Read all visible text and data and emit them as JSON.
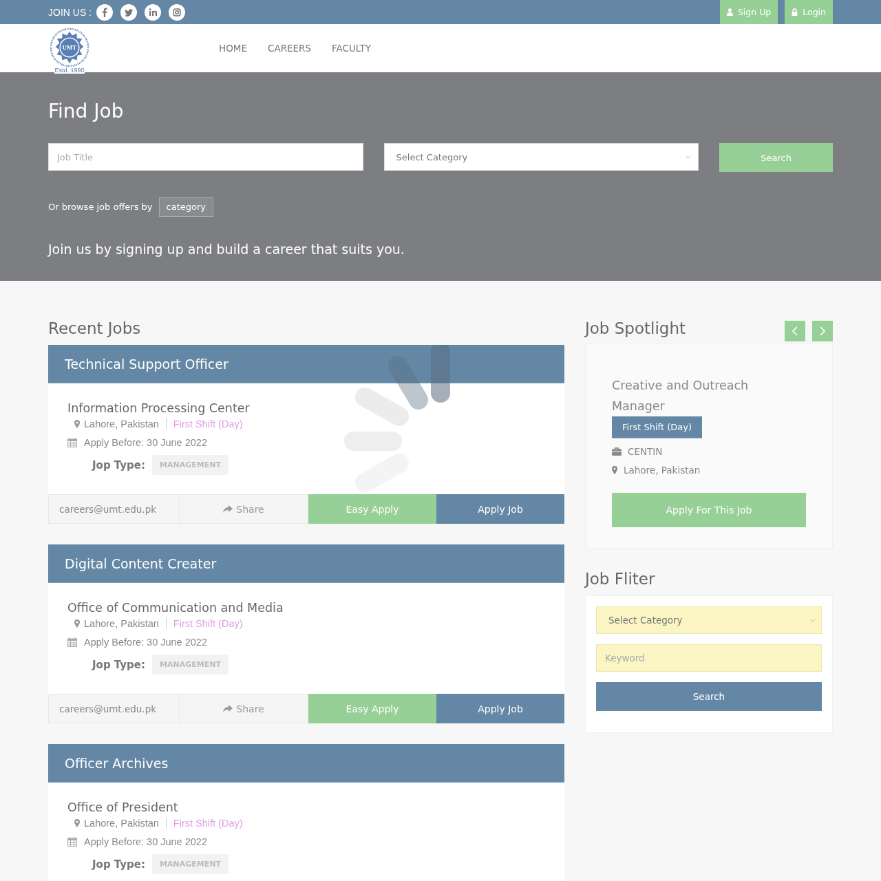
{
  "topbar": {
    "join_label": "JOIN US :",
    "social": [
      {
        "kind": "facebook"
      },
      {
        "kind": "twitter"
      },
      {
        "kind": "linkedin"
      },
      {
        "kind": "instagram"
      }
    ],
    "buttons": [
      {
        "label": "Sign Up",
        "kind": "user"
      },
      {
        "label": "Login",
        "kind": "lock"
      }
    ]
  },
  "logo": {
    "initials": "UMT",
    "established": "Estd. 1990"
  },
  "nav": [
    "HOME",
    "CAREERS",
    "FACULTY"
  ],
  "hero": {
    "title": "Find Job",
    "job_title_placeholder": "Job Title",
    "category_select": "Select Category",
    "search_button": "Search",
    "browse_text": "Or browse job offers by",
    "browse_button": "category",
    "tagline": "Join us by signing up and build a career that suits you."
  },
  "recent": {
    "heading": "Recent Jobs",
    "jobs": [
      {
        "title": "Technical Support Officer",
        "department": "Information Processing Center",
        "location": "Lahore, Pakistan",
        "shift": "First Shift (Day)",
        "deadline": "Apply Before: 30 June 2022",
        "type_label": "Jop Type:",
        "type": "MANAGEMENT",
        "email": "careers@umt.edu.pk",
        "share": "Share",
        "easy_apply": "Easy Apply",
        "apply": "Apply Job"
      },
      {
        "title": "Digital Content Creater",
        "department": "Office of Communication and Media",
        "location": "Lahore, Pakistan",
        "shift": "First Shift (Day)",
        "deadline": "Apply Before: 30 June 2022",
        "type_label": "Jop Type:",
        "type": "MANAGEMENT",
        "email": "careers@umt.edu.pk",
        "share": "Share",
        "easy_apply": "Easy Apply",
        "apply": "Apply Job"
      },
      {
        "title": "Officer Archives",
        "department": "Office of President",
        "location": "Lahore, Pakistan",
        "shift": "First Shift (Day)",
        "deadline": "Apply Before: 30 June 2022",
        "type_label": "Jop Type:",
        "type": "MANAGEMENT"
      }
    ]
  },
  "spotlight": {
    "heading": "Job Spotlight",
    "title": "Creative and Outreach Manager",
    "shift": "First Shift (Day)",
    "organization": "CENTIN",
    "location": "Lahore, Pakistan",
    "button": "Apply For This Job"
  },
  "filter": {
    "heading": "Job Fliter",
    "category_select": "Select Category",
    "keyword_placeholder": "Keyword",
    "search_button": "Search"
  }
}
